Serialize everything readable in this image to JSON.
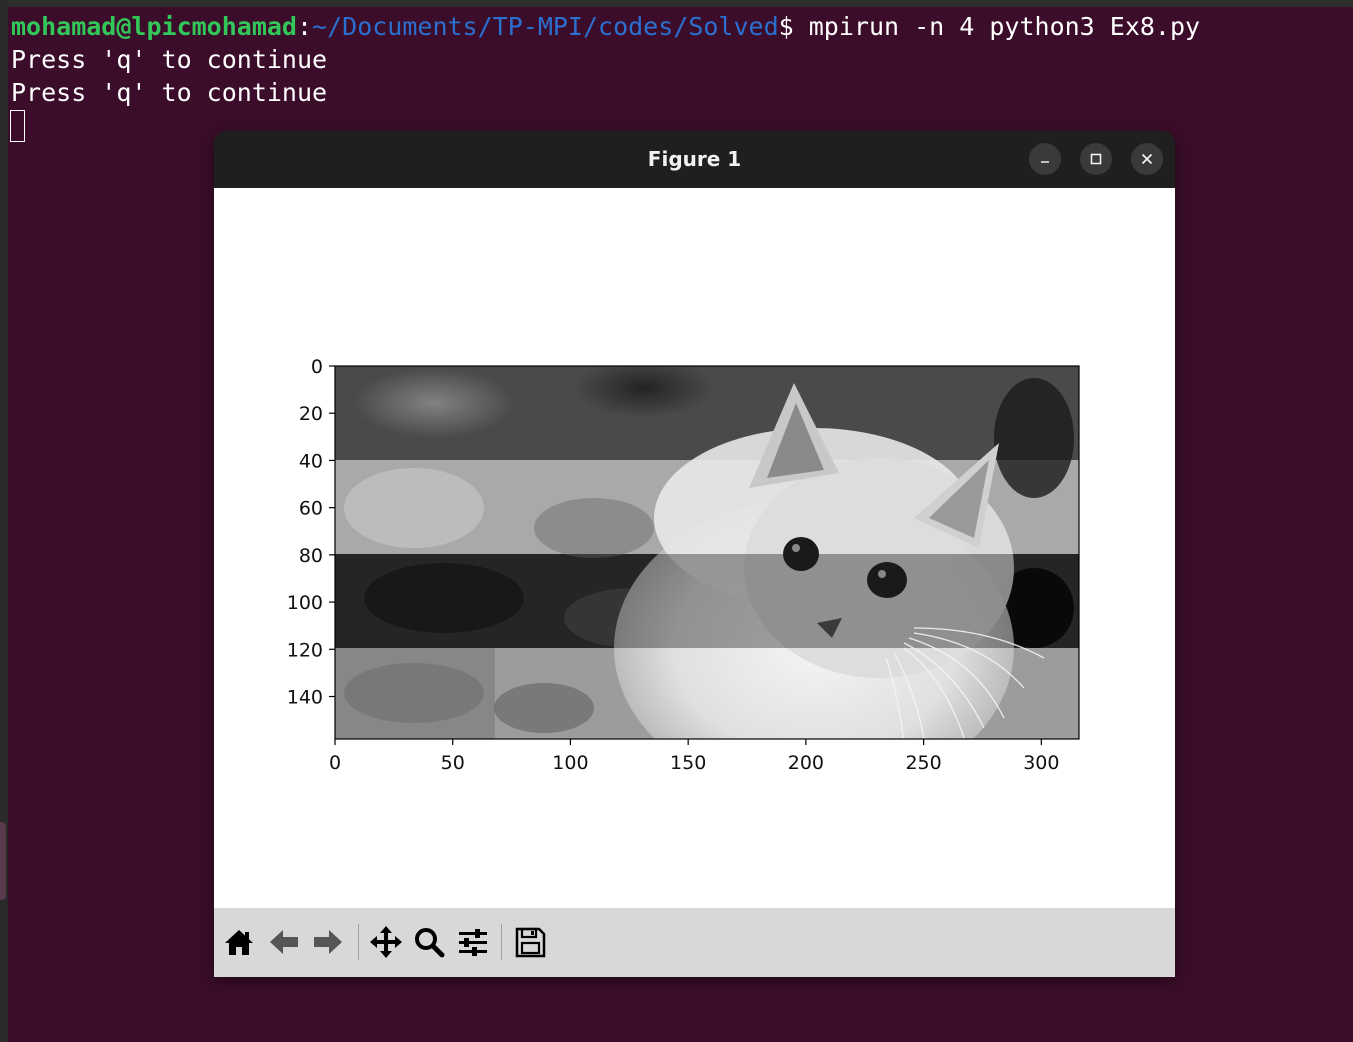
{
  "terminal": {
    "prompt_user": "mohamad@lpicmohamad",
    "prompt_colon": ":",
    "prompt_path": "~/Documents/TP-MPI/codes/Solved",
    "prompt_dollar": "$",
    "command": " mpirun -n 4 python3 Ex8.py",
    "output_lines": [
      "Press 'q' to continue",
      "Press 'q' to continue"
    ]
  },
  "window": {
    "title": "Figure 1",
    "buttons": {
      "minimize": "minimize-icon",
      "maximize": "maximize-icon",
      "close": "close-icon"
    }
  },
  "toolbar": {
    "icons": [
      "home-icon",
      "back-arrow-icon",
      "forward-arrow-icon",
      "pan-icon",
      "zoom-icon",
      "configure-subplots-icon",
      "save-icon"
    ]
  },
  "chart_data": {
    "type": "image",
    "title": "",
    "xlabel": "",
    "ylabel": "",
    "x_ticks": [
      0,
      50,
      100,
      150,
      200,
      250,
      300
    ],
    "y_ticks": [
      0,
      20,
      40,
      60,
      80,
      100,
      120,
      140
    ],
    "xlim": [
      0,
      316
    ],
    "ylim": [
      158,
      0
    ],
    "description_bands": [
      {
        "rows": [
          0,
          39
        ],
        "brightness": "dark"
      },
      {
        "rows": [
          39,
          79
        ],
        "brightness": "bright"
      },
      {
        "rows": [
          79,
          119
        ],
        "brightness": "dark"
      },
      {
        "rows": [
          119,
          158
        ],
        "brightness": "bright"
      }
    ]
  }
}
